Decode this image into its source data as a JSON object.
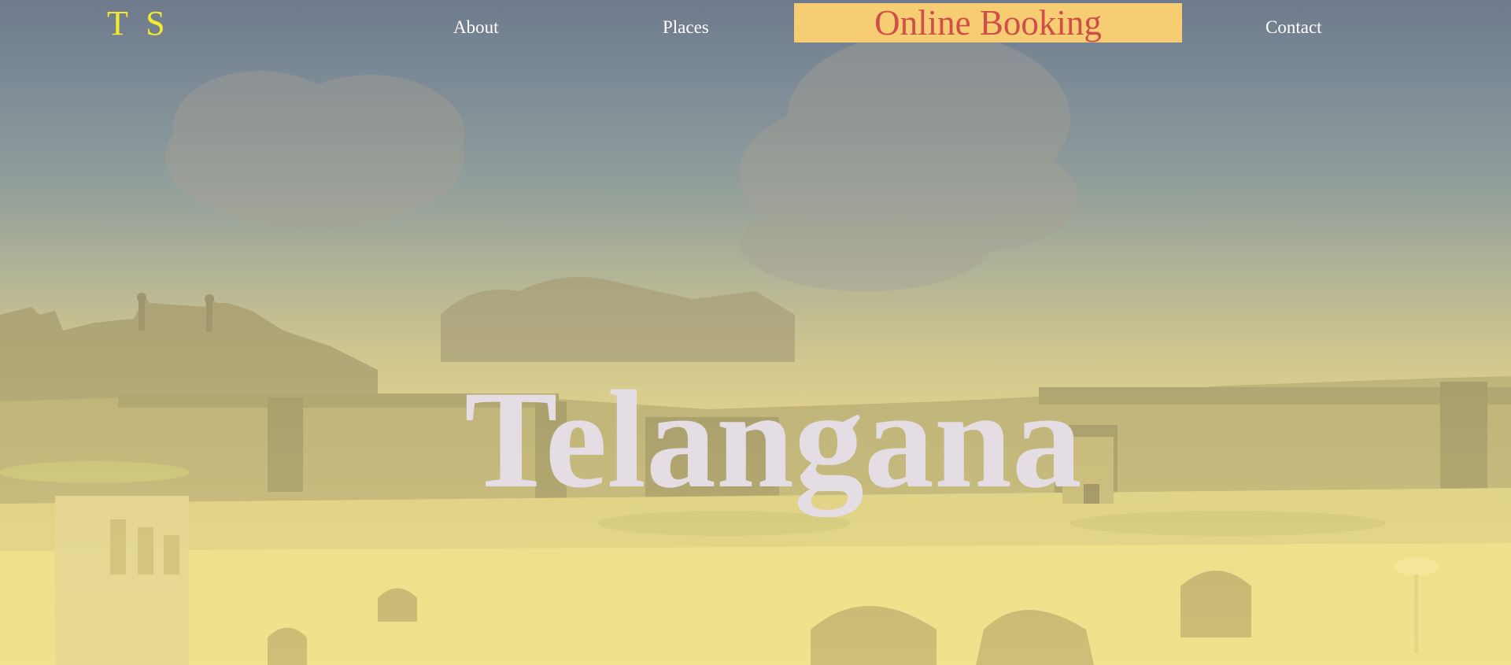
{
  "nav": {
    "logo": "T S",
    "links": [
      {
        "label": "About"
      },
      {
        "label": "Places"
      },
      {
        "label": "Contact"
      }
    ],
    "booking_label": "Online Booking"
  },
  "hero": {
    "title": "Telangana",
    "background": "golconda-fort-photo"
  },
  "colors": {
    "logo": "#f2ea2c",
    "booking_bg": "#f7cd74",
    "booking_text": "#d04e48",
    "title": "#e4dde3",
    "nav_text": "#ffffff"
  }
}
